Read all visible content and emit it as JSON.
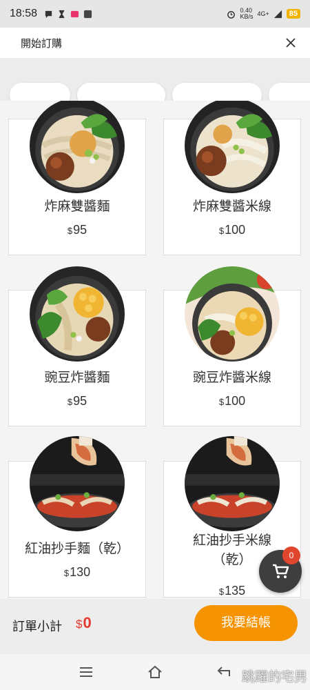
{
  "status_bar": {
    "time": "18:58",
    "net_speed_value": "0.40",
    "net_speed_unit": "KB/s",
    "network": "4G+",
    "battery": "85"
  },
  "header": {
    "title": "開始訂購"
  },
  "products": [
    {
      "name": "炸麻雙醬麵",
      "currency": "$",
      "price": "95"
    },
    {
      "name": "炸麻雙醬米線",
      "currency": "$",
      "price": "100"
    },
    {
      "name": "豌豆炸醬麵",
      "currency": "$",
      "price": "95"
    },
    {
      "name": "豌豆炸醬米線",
      "currency": "$",
      "price": "100"
    },
    {
      "name": "紅油抄手麵（乾）",
      "currency": "$",
      "price": "130"
    },
    {
      "name": "紅油抄手米線",
      "name_line2": "（乾）",
      "currency": "$",
      "price": "135"
    }
  ],
  "cart": {
    "count": "0"
  },
  "footer": {
    "subtotal_label": "訂單小計",
    "currency": "$",
    "subtotal_amount": "0",
    "checkout_label": "我要結帳"
  },
  "watermark": "跳躍的宅男",
  "colors": {
    "accent": "#f59400",
    "price_red": "#e23a2c",
    "badge": "#e0462d"
  }
}
